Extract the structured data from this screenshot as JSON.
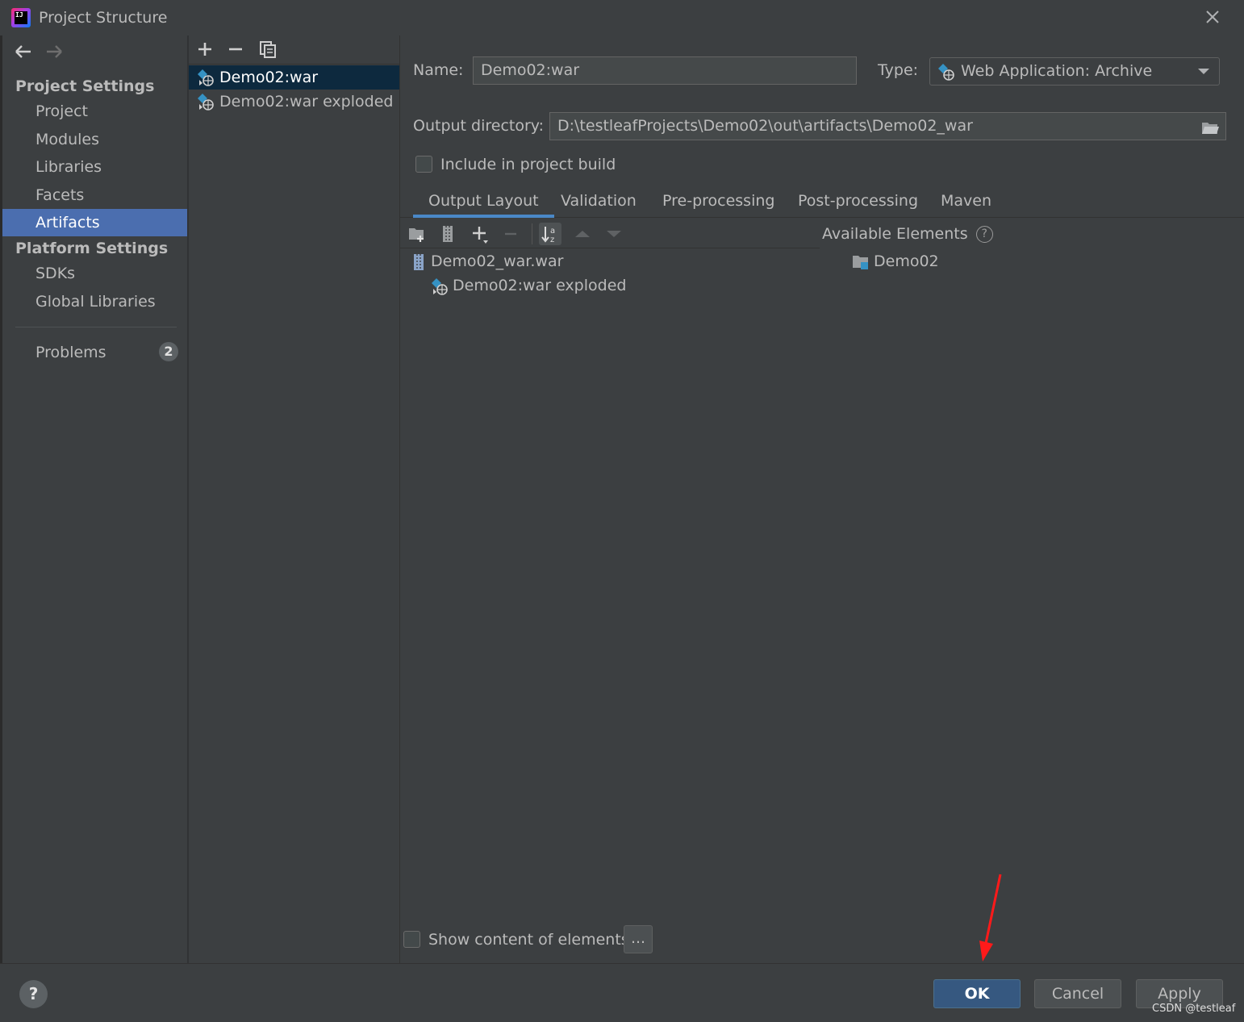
{
  "window": {
    "title": "Project Structure",
    "app_icon_text": "IJ"
  },
  "nav": {
    "back_icon": "arrow-left-icon",
    "forward_icon": "arrow-right-icon",
    "project_settings_header": "Project Settings",
    "project_settings_items": [
      "Project",
      "Modules",
      "Libraries",
      "Facets",
      "Artifacts"
    ],
    "selected_item": "Artifacts",
    "platform_settings_header": "Platform Settings",
    "platform_settings_items": [
      "SDKs",
      "Global Libraries"
    ],
    "problems_label": "Problems",
    "problems_count": "2"
  },
  "artifacts_list": {
    "toolbar": [
      "add-icon",
      "remove-icon",
      "copy-icon"
    ],
    "items": [
      {
        "label": "Demo02:war",
        "selected": true
      },
      {
        "label": "Demo02:war exploded",
        "selected": false
      }
    ]
  },
  "details": {
    "name_label": "Name:",
    "name_value": "Demo02:war",
    "type_label": "Type:",
    "type_value": "Web Application: Archive",
    "output_dir_label": "Output directory:",
    "output_dir_value": "D:\\testleafProjects\\Demo02\\out\\artifacts\\Demo02_war",
    "include_in_build_label": "Include in project build",
    "include_in_build_checked": false,
    "tabs": [
      "Output Layout",
      "Validation",
      "Pre-processing",
      "Post-processing",
      "Maven"
    ],
    "selected_tab": "Output Layout",
    "layout_toolbar": [
      "new-directory-icon",
      "archive-icon",
      "add-icon",
      "remove-icon",
      "sort-alpha-icon",
      "move-up-icon",
      "move-down-icon"
    ],
    "output_tree": [
      {
        "label": "Demo02_war.war",
        "icon": "archive-icon",
        "level": 0
      },
      {
        "label": "Demo02:war exploded",
        "icon": "web-artifact-icon",
        "level": 1
      }
    ],
    "available_elements_label": "Available Elements",
    "available_elements": [
      {
        "label": "Demo02",
        "icon": "module-folder-icon"
      }
    ],
    "show_content_label": "Show content of elements",
    "show_content_checked": false,
    "ellipsis_label": "..."
  },
  "footer": {
    "help_label": "?",
    "ok_label": "OK",
    "cancel_label": "Cancel",
    "apply_label": "Apply",
    "watermark": "CSDN @testleaf"
  },
  "colors": {
    "background": "#3c3f41",
    "selection": "#4b6eaf",
    "list_selection": "#0d293e",
    "default_button": "#365880",
    "annotation_arrow": "#ff1a1a"
  }
}
